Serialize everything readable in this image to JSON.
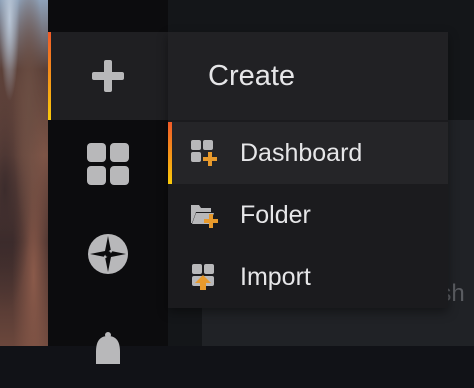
{
  "sidebar": {
    "items": [
      {
        "icon": "plus-icon"
      },
      {
        "icon": "dashboards-icon"
      },
      {
        "icon": "compass-icon"
      },
      {
        "icon": "bell-icon"
      }
    ]
  },
  "create_menu": {
    "title": "Create",
    "items": [
      {
        "label": "Dashboard",
        "icon": "dashboard-add-icon"
      },
      {
        "label": "Folder",
        "icon": "folder-add-icon"
      },
      {
        "label": "Import",
        "icon": "import-icon"
      }
    ]
  },
  "background": {
    "peek_text_1": "s",
    "peek_text_2": "ash"
  },
  "colors": {
    "accent_start": "#f05a28",
    "accent_end": "#fbca0a",
    "icon_grey": "#b8b8ba",
    "icon_orange": "#e89a2c"
  }
}
